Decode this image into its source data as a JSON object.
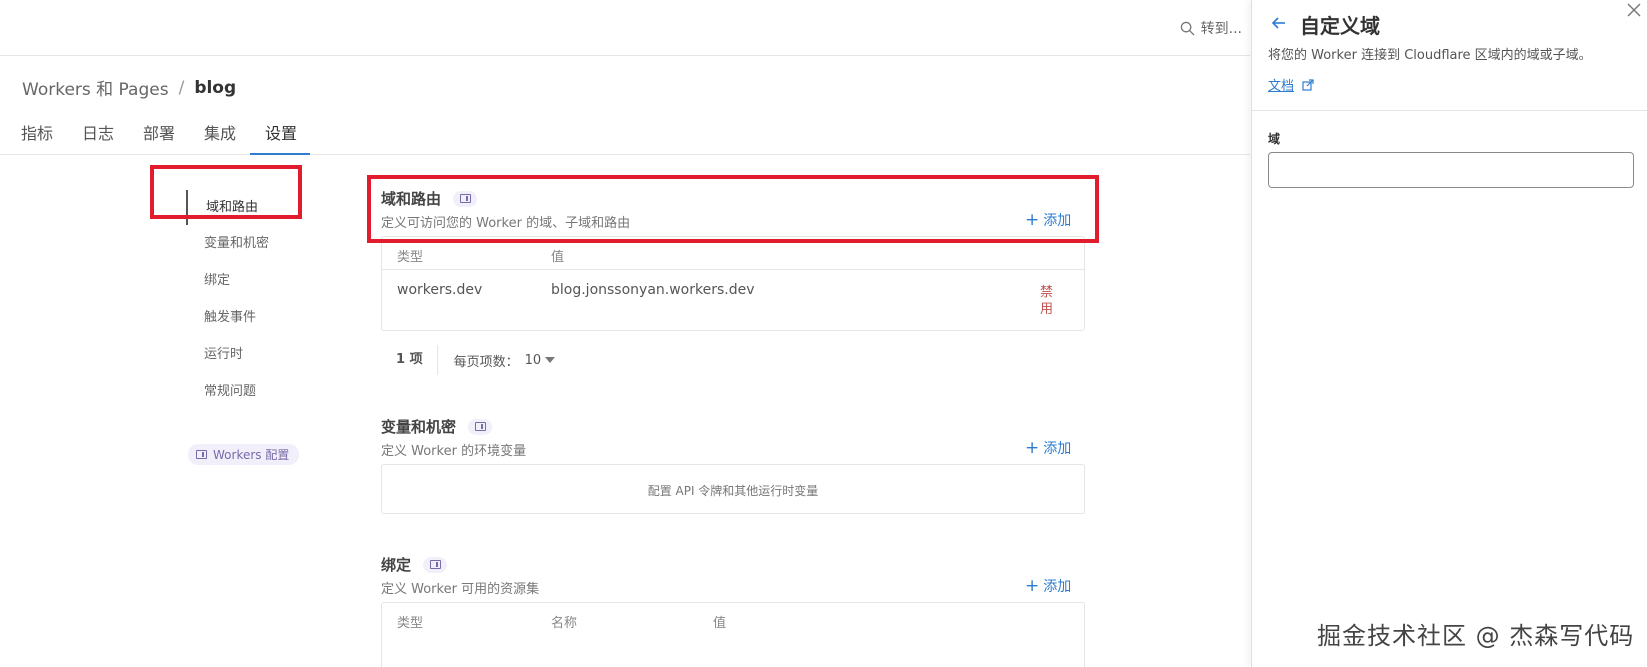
{
  "search": {
    "placeholder": "转到..."
  },
  "breadcrumb": {
    "root": "Workers 和 Pages",
    "separator": "/",
    "current": "blog"
  },
  "tabs": [
    "指标",
    "日志",
    "部署",
    "集成",
    "设置"
  ],
  "active_tab": "设置",
  "sidebar": {
    "items": [
      "域和路由",
      "变量和机密",
      "绑定",
      "触发事件",
      "运行时",
      "常规问题"
    ],
    "active": "域和路由",
    "workers_config": "Workers 配置"
  },
  "sections": {
    "domains": {
      "title": "域和路由",
      "subtitle": "定义可访问您的 Worker 的域、子域和路由",
      "add_label": "添加",
      "columns": [
        "类型",
        "值"
      ],
      "rows": [
        {
          "type": "workers.dev",
          "value": "blog.jonssonyan.workers.dev",
          "action": "禁用"
        }
      ],
      "pager": {
        "count": "1 项",
        "per_page_label": "每页项数：",
        "per_page_value": "10"
      }
    },
    "variables": {
      "title": "变量和机密",
      "subtitle": "定义 Worker 的环境变量",
      "add_label": "添加",
      "empty_text": "配置 API 令牌和其他运行时变量"
    },
    "bindings": {
      "title": "绑定",
      "subtitle": "定义 Worker 可用的资源集",
      "add_label": "添加",
      "columns": [
        "类型",
        "名称",
        "值"
      ]
    }
  },
  "drawer": {
    "title": "自定义域",
    "description": "将您的 Worker 连接到 Cloudflare 区域内的域或子域。",
    "doc_link": "文档",
    "field_label": "域",
    "field_value": ""
  },
  "watermark": "掘金技术社区 @ 杰森写代码",
  "colors": {
    "accent": "#2c7cd1",
    "annotation": "#e11d2d",
    "danger": "#c0504d",
    "badge_bg": "#f1effa"
  }
}
